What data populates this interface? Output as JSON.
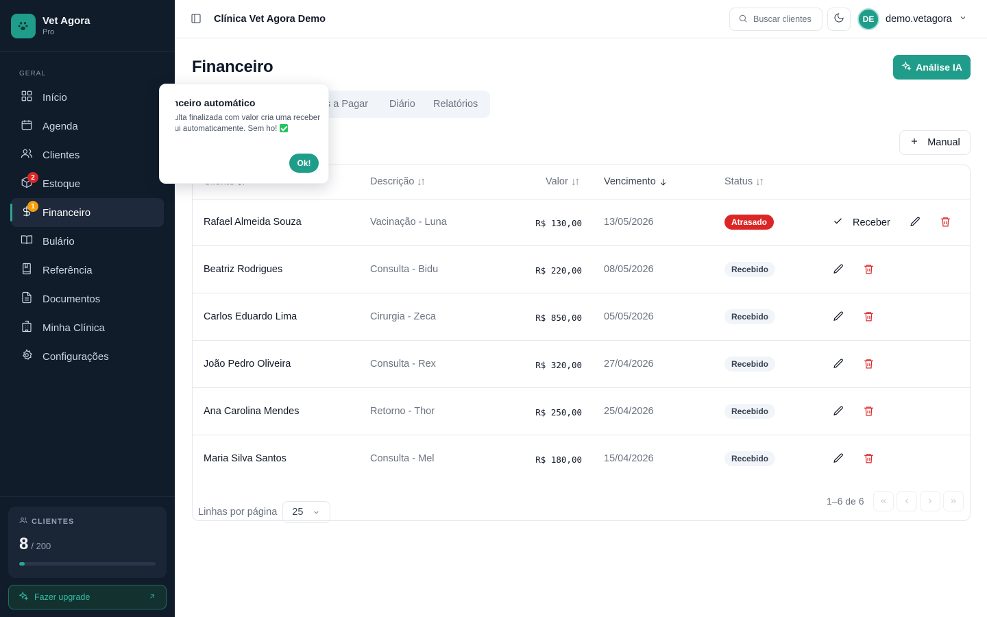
{
  "app": {
    "name": "Vet Agora",
    "plan": "Pro"
  },
  "sidebar": {
    "section_label": "GERAL",
    "items": [
      {
        "label": "Início",
        "icon": "grid-icon"
      },
      {
        "label": "Agenda",
        "icon": "calendar-icon"
      },
      {
        "label": "Clientes",
        "icon": "users-icon"
      },
      {
        "label": "Estoque",
        "icon": "box-icon",
        "badge": "2"
      },
      {
        "label": "Financeiro",
        "icon": "dollar-icon",
        "badge": "1",
        "active": true
      },
      {
        "label": "Bulário",
        "icon": "book-icon"
      },
      {
        "label": "Referência",
        "icon": "bookmark-book-icon"
      },
      {
        "label": "Documentos",
        "icon": "file-text-icon"
      },
      {
        "label": "Minha Clínica",
        "icon": "building-icon"
      },
      {
        "label": "Configurações",
        "icon": "settings-icon"
      }
    ],
    "clients_card": {
      "label": "CLIENTES",
      "count": "8",
      "limit": "/ 200",
      "usage_fraction": 0.04
    },
    "upgrade_label": "Fazer upgrade"
  },
  "header": {
    "clinic_name": "Clínica Vet Agora Demo",
    "search_placeholder": "Buscar clientes",
    "user_initials": "DE",
    "user_name": "demo.vetagora"
  },
  "page": {
    "title": "Financeiro",
    "ai_button": "Análise IA",
    "manual_button": "Manual",
    "tabs": [
      "s a Pagar",
      "Diário",
      "Relatórios"
    ]
  },
  "popover": {
    "title": "anceiro automático",
    "body": "nsulta finalizada com valor cria uma receber aqui automaticamente. Sem ho!",
    "ok_label": "Ok!"
  },
  "table": {
    "columns": {
      "client": "Cliente",
      "description": "Descrição",
      "value": "Valor",
      "due": "Vencimento",
      "status": "Status"
    },
    "receive_label": "Receber",
    "rows": [
      {
        "client": "Rafael Almeida Souza",
        "description": "Vacinação - Luna",
        "value": "R$ 130,00",
        "due": "13/05/2026",
        "status": "Atrasado",
        "late": true
      },
      {
        "client": "Beatriz Rodrigues",
        "description": "Consulta - Bidu",
        "value": "R$ 220,00",
        "due": "08/05/2026",
        "status": "Recebido",
        "late": false
      },
      {
        "client": "Carlos Eduardo Lima",
        "description": "Cirurgia - Zeca",
        "value": "R$ 850,00",
        "due": "05/05/2026",
        "status": "Recebido",
        "late": false
      },
      {
        "client": "João Pedro Oliveira",
        "description": "Consulta - Rex",
        "value": "R$ 320,00",
        "due": "27/04/2026",
        "status": "Recebido",
        "late": false
      },
      {
        "client": "Ana Carolina Mendes",
        "description": "Retorno - Thor",
        "value": "R$ 250,00",
        "due": "25/04/2026",
        "status": "Recebido",
        "late": false
      },
      {
        "client": "Maria Silva Santos",
        "description": "Consulta - Mel",
        "value": "R$ 180,00",
        "due": "15/04/2026",
        "status": "Recebido",
        "late": false
      }
    ],
    "footer": {
      "rows_label": "Linhas por página",
      "rows_value": "25",
      "range": "1–6 de 6"
    }
  },
  "colors": {
    "accent": "#1f9d8a",
    "sidebar_bg": "#111c2b",
    "danger": "#dc2626"
  }
}
